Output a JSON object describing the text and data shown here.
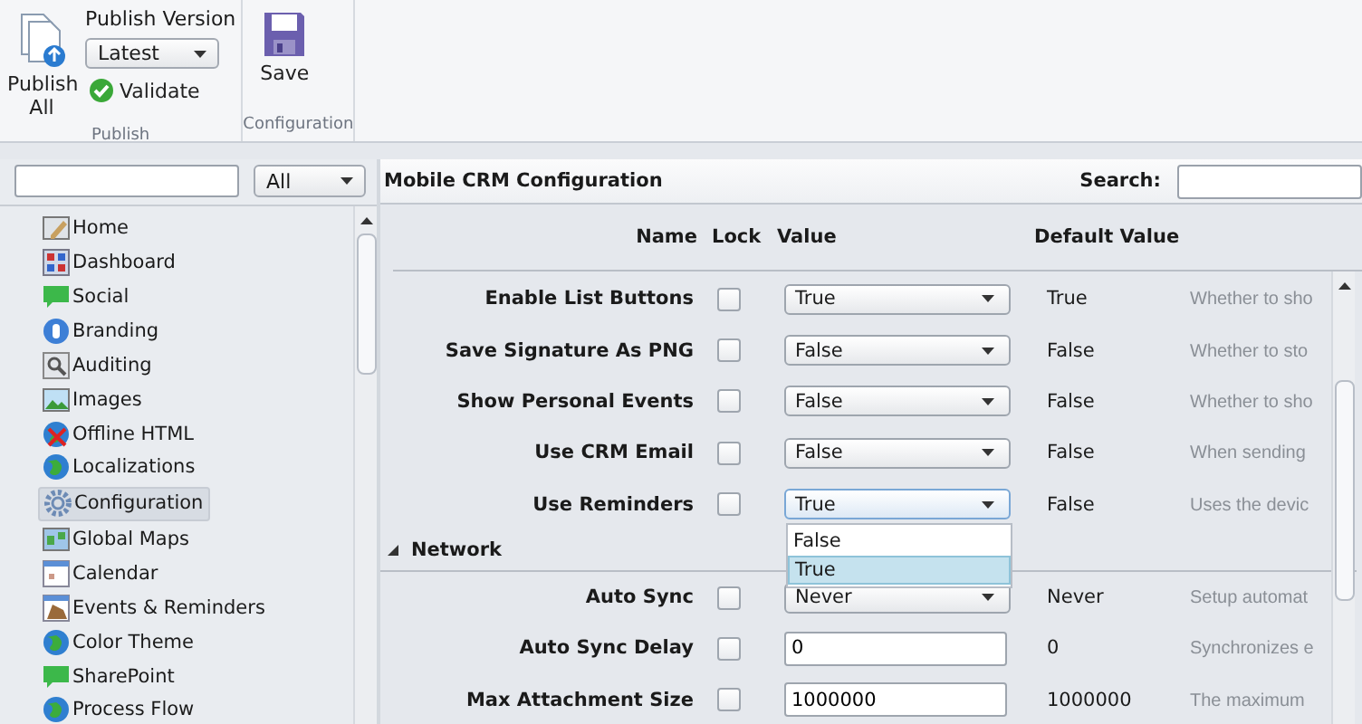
{
  "ribbon": {
    "groups": [
      {
        "label": "Publish",
        "publish_all": "Publish All",
        "version_label": "Publish Version",
        "version": "Latest",
        "validate": "Validate"
      },
      {
        "label": "Configuration",
        "save": "Save"
      }
    ]
  },
  "sidebar": {
    "filter": "All",
    "items": [
      {
        "label": "Home",
        "selected": false
      },
      {
        "label": "Dashboard",
        "selected": false
      },
      {
        "label": "Social",
        "selected": false
      },
      {
        "label": "Branding",
        "selected": false
      },
      {
        "label": "Auditing",
        "selected": false
      },
      {
        "label": "Images",
        "selected": false
      },
      {
        "label": "Offline HTML",
        "selected": false
      },
      {
        "label": "Localizations",
        "selected": false
      },
      {
        "label": "Configuration",
        "selected": true
      },
      {
        "label": "Global Maps",
        "selected": false
      },
      {
        "label": "Calendar",
        "selected": false
      },
      {
        "label": "Events & Reminders",
        "selected": false
      },
      {
        "label": "Color Theme",
        "selected": false
      },
      {
        "label": "SharePoint",
        "selected": false
      },
      {
        "label": "Process Flow",
        "selected": false
      }
    ]
  },
  "main": {
    "title": "Mobile CRM Configuration",
    "search_label": "Search:",
    "columns": [
      "Name",
      "Lock",
      "Value",
      "Default Value"
    ],
    "rows": [
      {
        "kind": "select",
        "name": "Enable List Buttons",
        "locked": false,
        "value": "True",
        "default": "True",
        "description": "Whether to sho"
      },
      {
        "kind": "select",
        "name": "Save Signature As PNG",
        "locked": false,
        "value": "False",
        "default": "False",
        "description": "Whether to sto"
      },
      {
        "kind": "select",
        "name": "Show Personal Events",
        "locked": false,
        "value": "False",
        "default": "False",
        "description": "Whether to sho"
      },
      {
        "kind": "select",
        "name": "Use CRM Email",
        "locked": false,
        "value": "False",
        "default": "False",
        "description": "When sending"
      },
      {
        "kind": "select",
        "name": "Use Reminders",
        "locked": false,
        "value": "True",
        "default": "False",
        "description": "Uses the devic",
        "open": true,
        "options": [
          {
            "label": "False",
            "selected": false
          },
          {
            "label": "True",
            "selected": true
          }
        ]
      },
      {
        "kind": "group",
        "name": "Network",
        "expanded": true
      },
      {
        "kind": "select",
        "name": "Auto Sync",
        "locked": false,
        "value": "Never",
        "default": "Never",
        "description": "Setup automat"
      },
      {
        "kind": "text",
        "name": "Auto Sync Delay",
        "locked": false,
        "value": "0",
        "default": "0",
        "description": "Synchronizes e"
      },
      {
        "kind": "text",
        "name": "Max Attachment Size",
        "locked": false,
        "value": "1000000",
        "default": "1000000",
        "description": "The maximum"
      }
    ]
  }
}
